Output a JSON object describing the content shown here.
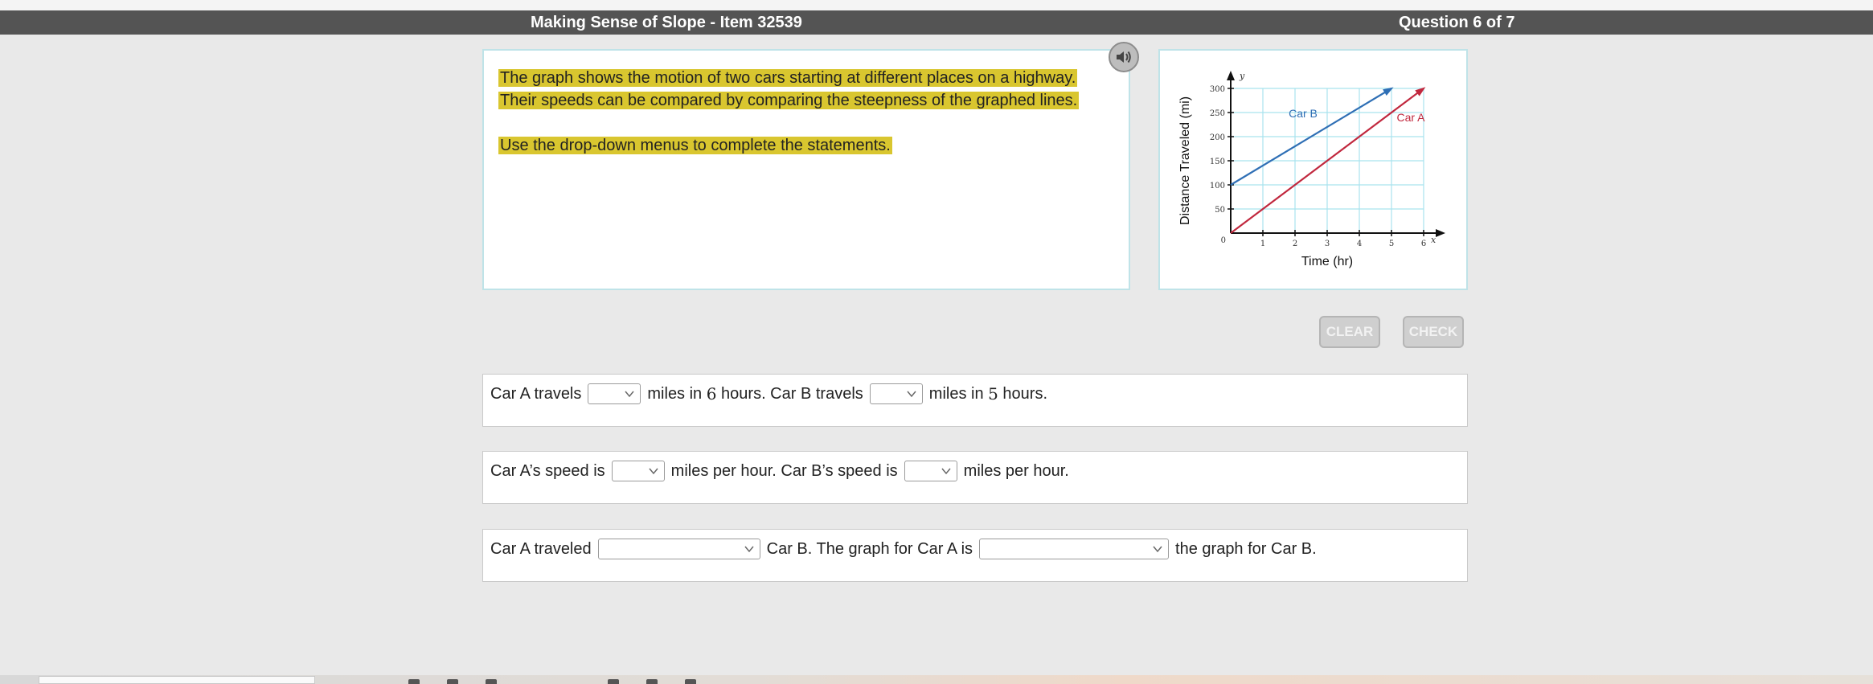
{
  "header": {
    "title": "Making Sense of Slope - Item 32539",
    "question_counter": "Question 6 of 7"
  },
  "stem": {
    "line1": "The graph shows the motion of two cars starting at different places on a highway.",
    "line2": "Their speeds can be compared by comparing the steepness of the graphed lines.",
    "line3": "Use the drop-down menus to complete the statements."
  },
  "speaker": {
    "icon": "speaker-icon"
  },
  "graph": {
    "ylabel": "Distance Traveled (mi)",
    "xlabel": "Time (hr)",
    "y_axis_letter": "y",
    "x_axis_letter": "x",
    "origin_label": "0"
  },
  "chart_data": {
    "type": "line",
    "xlabel": "Time (hr)",
    "ylabel": "Distance Traveled (mi)",
    "xlim": [
      0,
      6
    ],
    "ylim": [
      0,
      300
    ],
    "x_ticks": [
      "1",
      "2",
      "3",
      "4",
      "5",
      "6"
    ],
    "y_ticks": [
      "50",
      "100",
      "150",
      "200",
      "250",
      "300"
    ],
    "series": [
      {
        "name": "Car B",
        "color": "#2f6fb5",
        "x": [
          0,
          5
        ],
        "y": [
          100,
          300
        ]
      },
      {
        "name": "Car A",
        "color": "#c1283e",
        "x": [
          0,
          6
        ],
        "y": [
          0,
          300
        ]
      }
    ],
    "grid": true
  },
  "buttons": {
    "clear": "CLEAR",
    "check": "CHECK"
  },
  "questions": {
    "q1": {
      "p1": "Car A travels",
      "p2": "miles in ",
      "n1": "6",
      "p3": " hours. Car B travels",
      "p4": "miles in ",
      "n2": "5",
      "p5": " hours."
    },
    "q2": {
      "p1": "Car A’s speed is",
      "p2": "miles per hour. Car B’s speed is",
      "p3": "miles per hour."
    },
    "q3": {
      "p1": "Car A traveled",
      "p2": "Car B. The graph for Car A is",
      "p3": "the graph for Car B."
    }
  }
}
